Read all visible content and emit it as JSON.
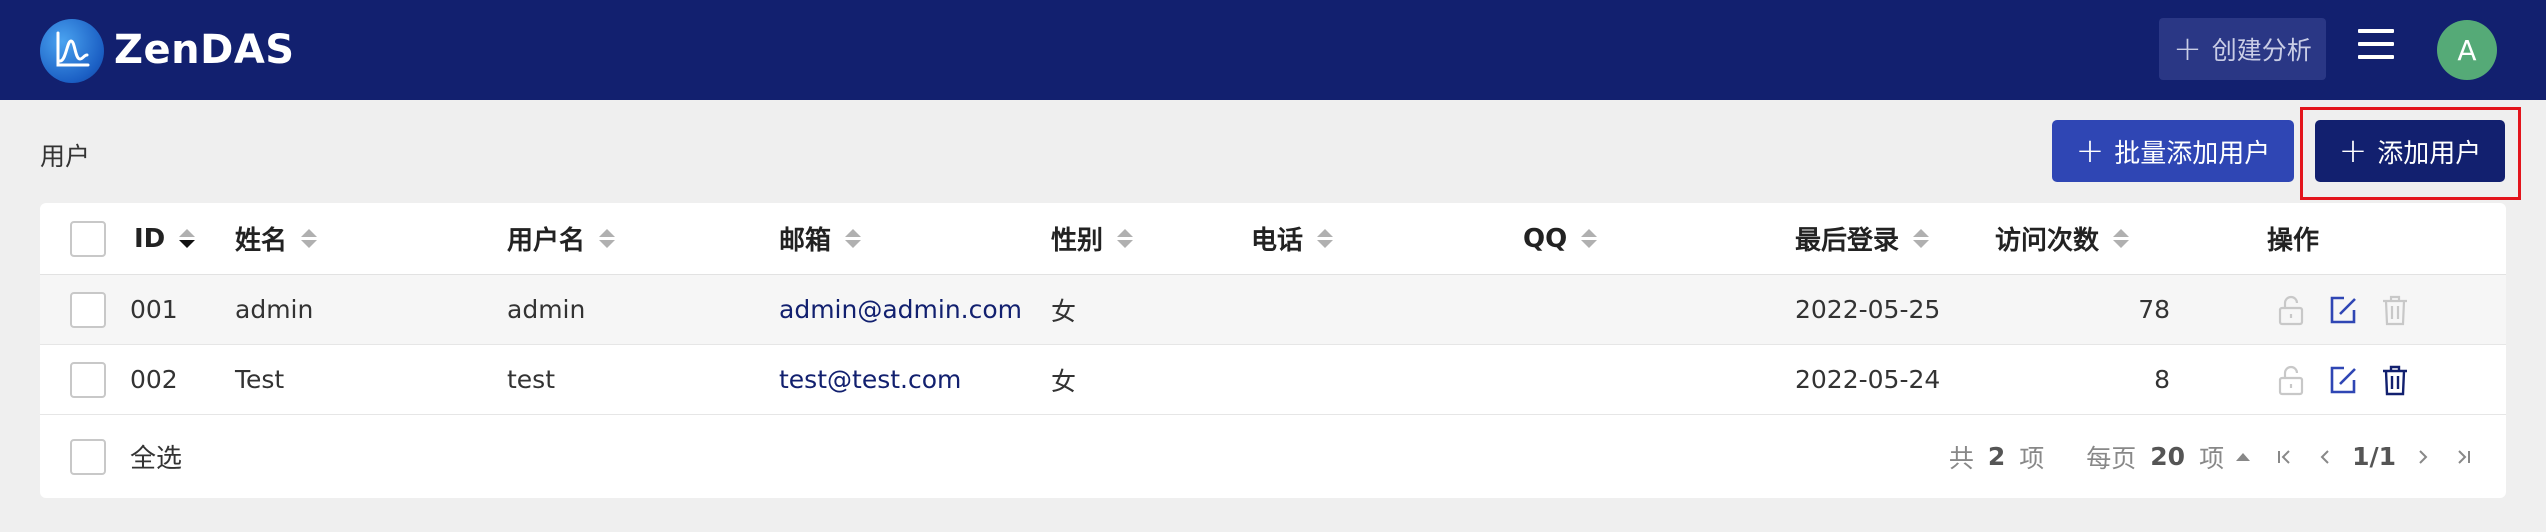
{
  "header": {
    "app_name": "ZenDAS",
    "create_analysis_label": "创建分析",
    "avatar_initial": "A",
    "background_color": "#12206f"
  },
  "page": {
    "title": "用户",
    "bulk_add_label": "批量添加用户",
    "add_user_label": "添加用户"
  },
  "table": {
    "columns": [
      "ID",
      "姓名",
      "用户名",
      "邮箱",
      "性别",
      "电话",
      "QQ",
      "最后登录",
      "访问次数",
      "操作"
    ],
    "rows": [
      {
        "id": "001",
        "name": "admin",
        "username": "admin",
        "email": "admin@admin.com",
        "gender": "女",
        "phone": "",
        "qq": "",
        "last_login": "2022-05-25",
        "visits": "78"
      },
      {
        "id": "002",
        "name": "Test",
        "username": "test",
        "email": "test@test.com",
        "gender": "女",
        "phone": "",
        "qq": "",
        "last_login": "2022-05-24",
        "visits": "8"
      }
    ]
  },
  "footer": {
    "select_all_label": "全选",
    "total_prefix": "共",
    "total_count": "2",
    "total_suffix": "项",
    "per_page_prefix": "每页",
    "per_page_count": "20",
    "per_page_suffix": "项",
    "page_indicator": "1/1"
  },
  "icons": {
    "logo": "chart-wave-logo-icon",
    "menu": "hamburger-menu-icon",
    "row_actions": [
      "lock-icon",
      "edit-icon",
      "trash-icon"
    ]
  },
  "colors": {
    "primary": "#12206f",
    "bulk_button": "#2f46b4",
    "highlight": "#e3141c",
    "avatar": "#55aa77"
  }
}
